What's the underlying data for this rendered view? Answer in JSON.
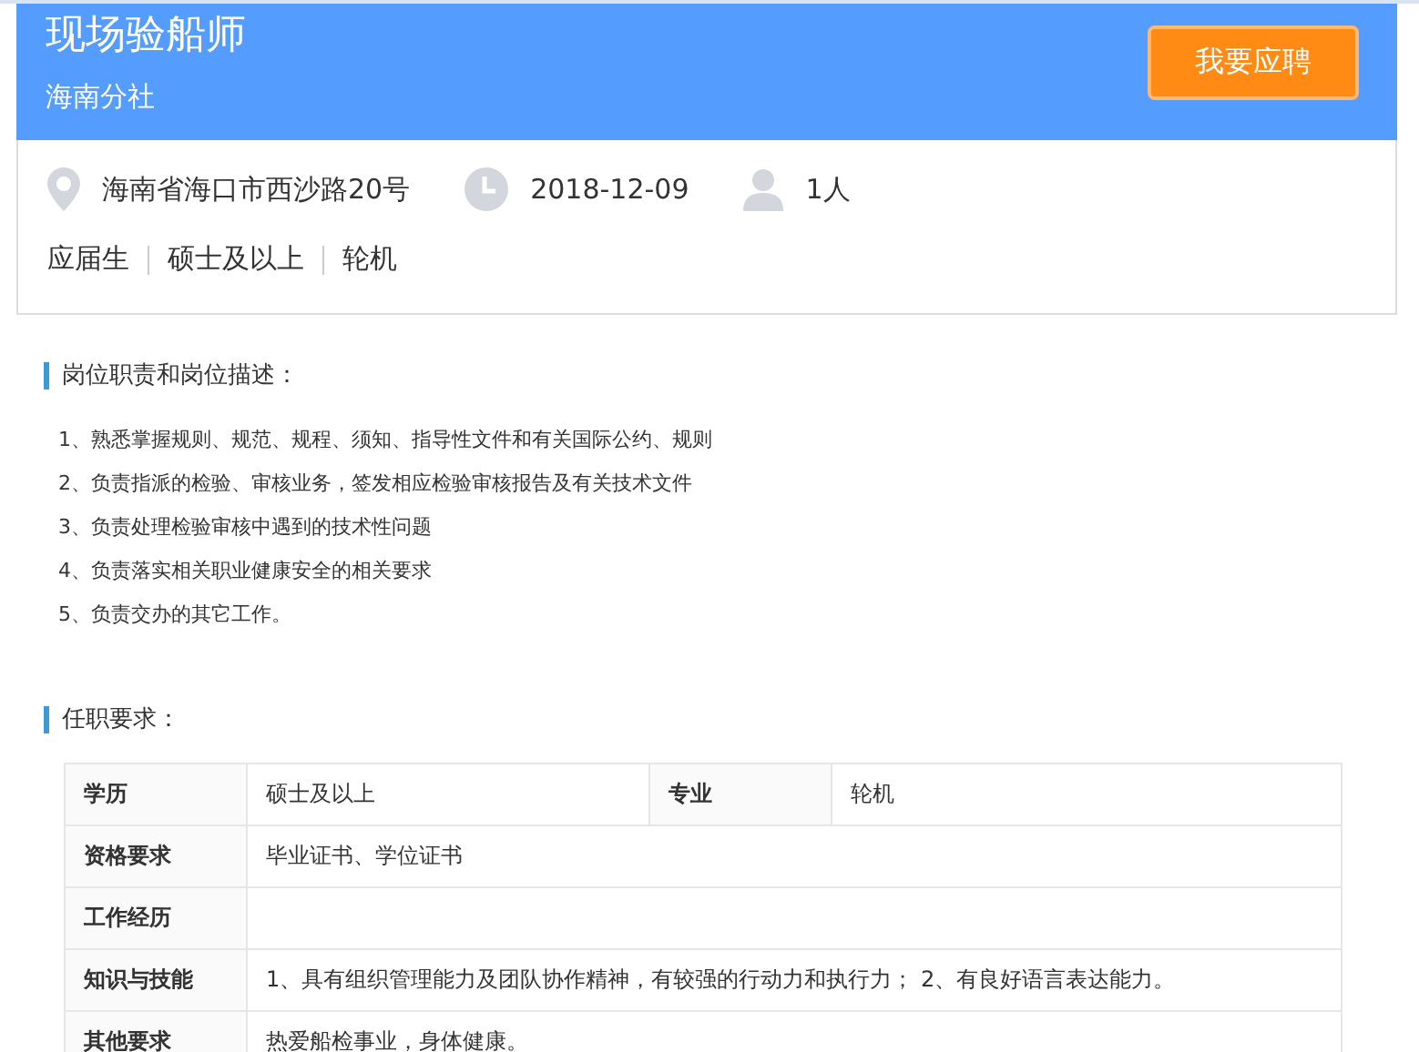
{
  "job": {
    "title": "现场验船师",
    "branch": "海南分社",
    "apply_button": "我要应聘",
    "location": "海南省海口市西沙路20号",
    "date": "2018-12-09",
    "headcount": "1人",
    "tags": [
      "应届生",
      "硕士及以上",
      "轮机"
    ]
  },
  "duties": {
    "heading": "岗位职责和岗位描述：",
    "items": [
      "1、熟悉掌握规则、规范、规程、须知、指导性文件和有关国际公约、规则",
      "2、负责指派的检验、审核业务，签发相应检验审核报告及有关技术文件",
      "3、负责处理检验审核中遇到的技术性问题",
      "4、负责落实相关职业健康安全的相关要求",
      "5、负责交办的其它工作。"
    ]
  },
  "requirements": {
    "heading": "任职要求：",
    "rows": [
      {
        "cells": [
          {
            "text": "学历",
            "header": true
          },
          {
            "text": "硕士及以上"
          },
          {
            "text": "专业",
            "header": true
          },
          {
            "text": "轮机"
          }
        ]
      },
      {
        "cells": [
          {
            "text": "资格要求",
            "header": true
          },
          {
            "text": "毕业证书、学位证书",
            "colspan": 3
          }
        ]
      },
      {
        "cells": [
          {
            "text": "工作经历",
            "header": true
          },
          {
            "colspan": 3
          }
        ]
      },
      {
        "cells": [
          {
            "text": "知识与技能",
            "header": true
          },
          {
            "text": "1、具有组织管理能力及团队协作精神，有较强的行动力和执行力； 2、有良好语言表达能力。",
            "colspan": 3
          }
        ]
      },
      {
        "cells": [
          {
            "text": "其他要求",
            "header": true
          },
          {
            "text": "热爱船检事业，身体健康。",
            "colspan": 3
          }
        ]
      }
    ]
  }
}
